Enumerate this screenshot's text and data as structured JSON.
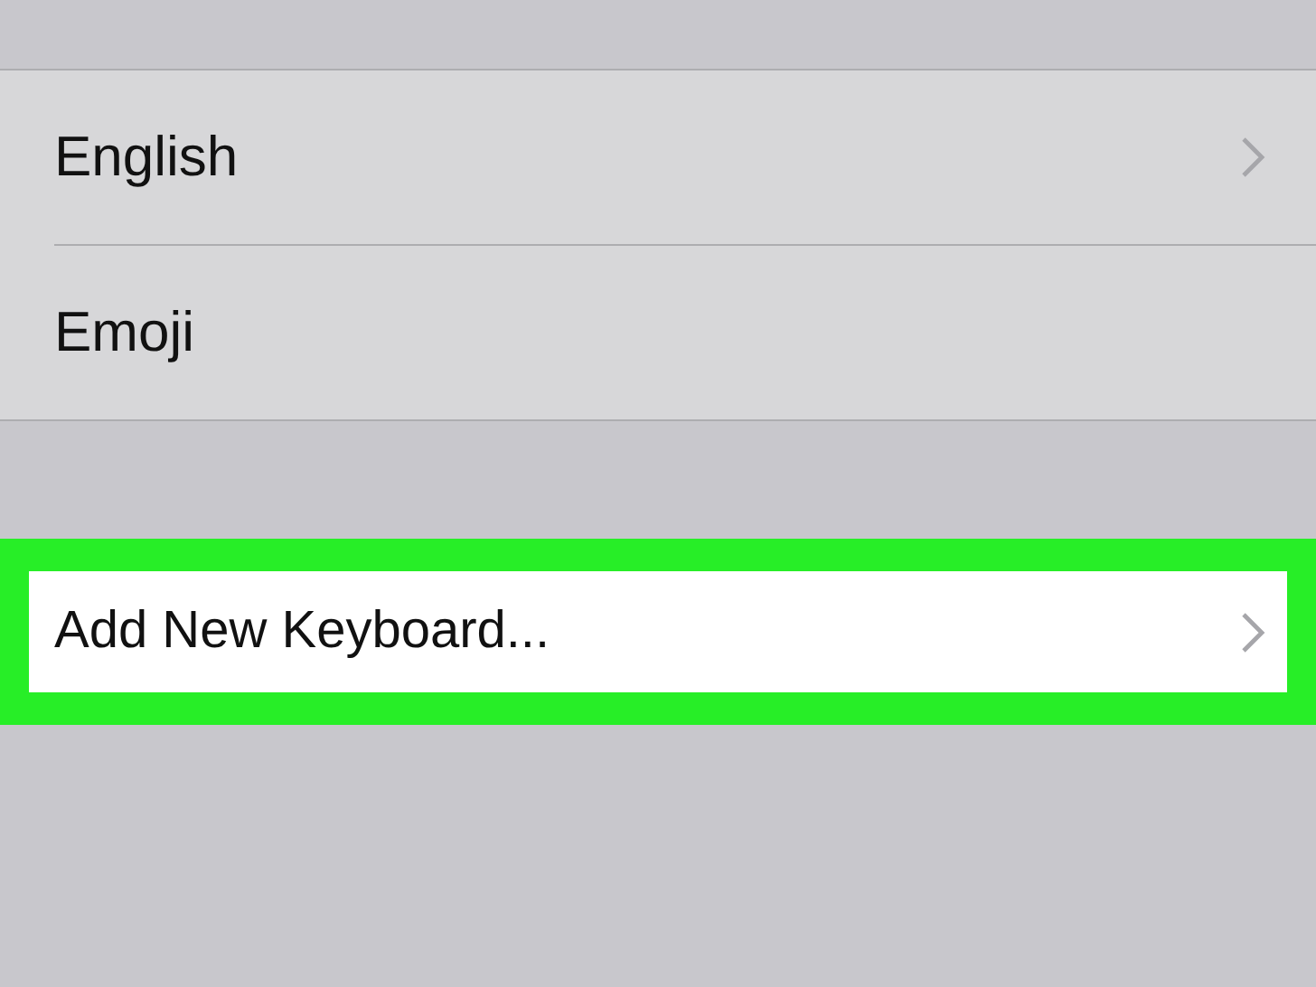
{
  "groups": [
    {
      "rows": [
        {
          "label": "English",
          "chevron": true,
          "highlighted": false
        },
        {
          "label": "Emoji",
          "chevron": false,
          "highlighted": false
        }
      ]
    },
    {
      "rows": [
        {
          "label": "Add New Keyboard...",
          "chevron": true,
          "highlighted": true
        }
      ]
    }
  ]
}
